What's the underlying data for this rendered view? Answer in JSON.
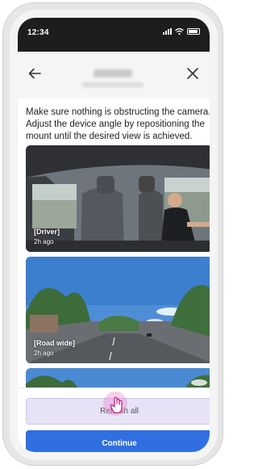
{
  "status_bar": {
    "time": "12:34"
  },
  "header": {
    "back_icon": "arrow-left-icon",
    "close_icon": "close-icon"
  },
  "instructions": "Make sure nothing is obstructing the camera. Adjust the device angle by repositioning the mount until the desired view is achieved.",
  "cameras": [
    {
      "label": "[Driver]",
      "time": "2h ago"
    },
    {
      "label": "[Road wide]",
      "time": "2h ago"
    }
  ],
  "actions": {
    "refresh_label": "Refresh all",
    "continue_label": "Continue"
  },
  "colors": {
    "accent": "#2f6fe0",
    "refresh_bg": "#e6e3f7",
    "status_bar": "#1d1d1f"
  }
}
